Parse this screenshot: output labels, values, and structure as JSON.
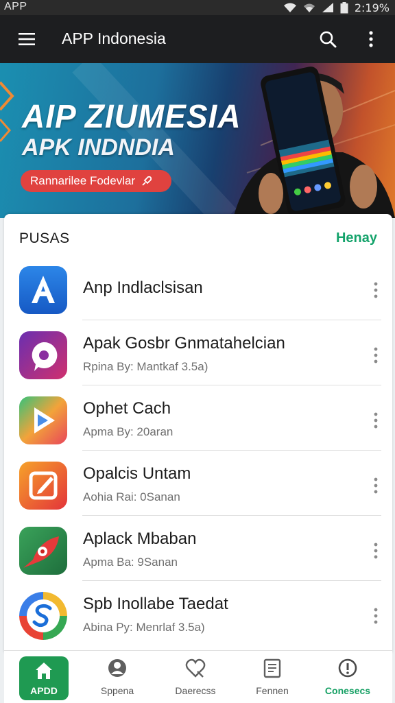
{
  "status_bar": {
    "carrier": "APP",
    "time": "2:19%"
  },
  "app_bar": {
    "title": "APP Indonesia"
  },
  "banner": {
    "headline": "AIP ZIUMESIA",
    "subheadline": "APK INDNDIA",
    "cta_label": "Rannarilee Fodevlar"
  },
  "section": {
    "title": "PUSAS",
    "link": "Henay"
  },
  "apps": [
    {
      "name": "Anp Indlaclsisan",
      "sub": ""
    },
    {
      "name": "Apak Gosbr Gnmatahelcian",
      "sub": "Rpina By: Mantkaf 3.5a)"
    },
    {
      "name": "Ophet Cach",
      "sub": "Apma By: 20aran"
    },
    {
      "name": "Opalcis Untam",
      "sub": "Aohia Rai: 0Sanan"
    },
    {
      "name": "Aplack Mbaban",
      "sub": "Apma Ba: 9Sanan"
    },
    {
      "name": "Spb Inollabe Taedat",
      "sub": "Abina Py: Menrlaf 3.5a)"
    }
  ],
  "bottom_nav": [
    {
      "label": "APDD",
      "icon": "home-icon"
    },
    {
      "label": "Sppena",
      "icon": "profile-icon"
    },
    {
      "label": "Daerecss",
      "icon": "heart-tag-icon"
    },
    {
      "label": "Fennen",
      "icon": "document-icon"
    },
    {
      "label": "Conesecs",
      "icon": "info-icon"
    }
  ],
  "colors": {
    "accent_green": "#1f9a52",
    "link_green": "#14a36b",
    "app_bar": "#1d1e20",
    "cta_red": "#e0423f"
  }
}
